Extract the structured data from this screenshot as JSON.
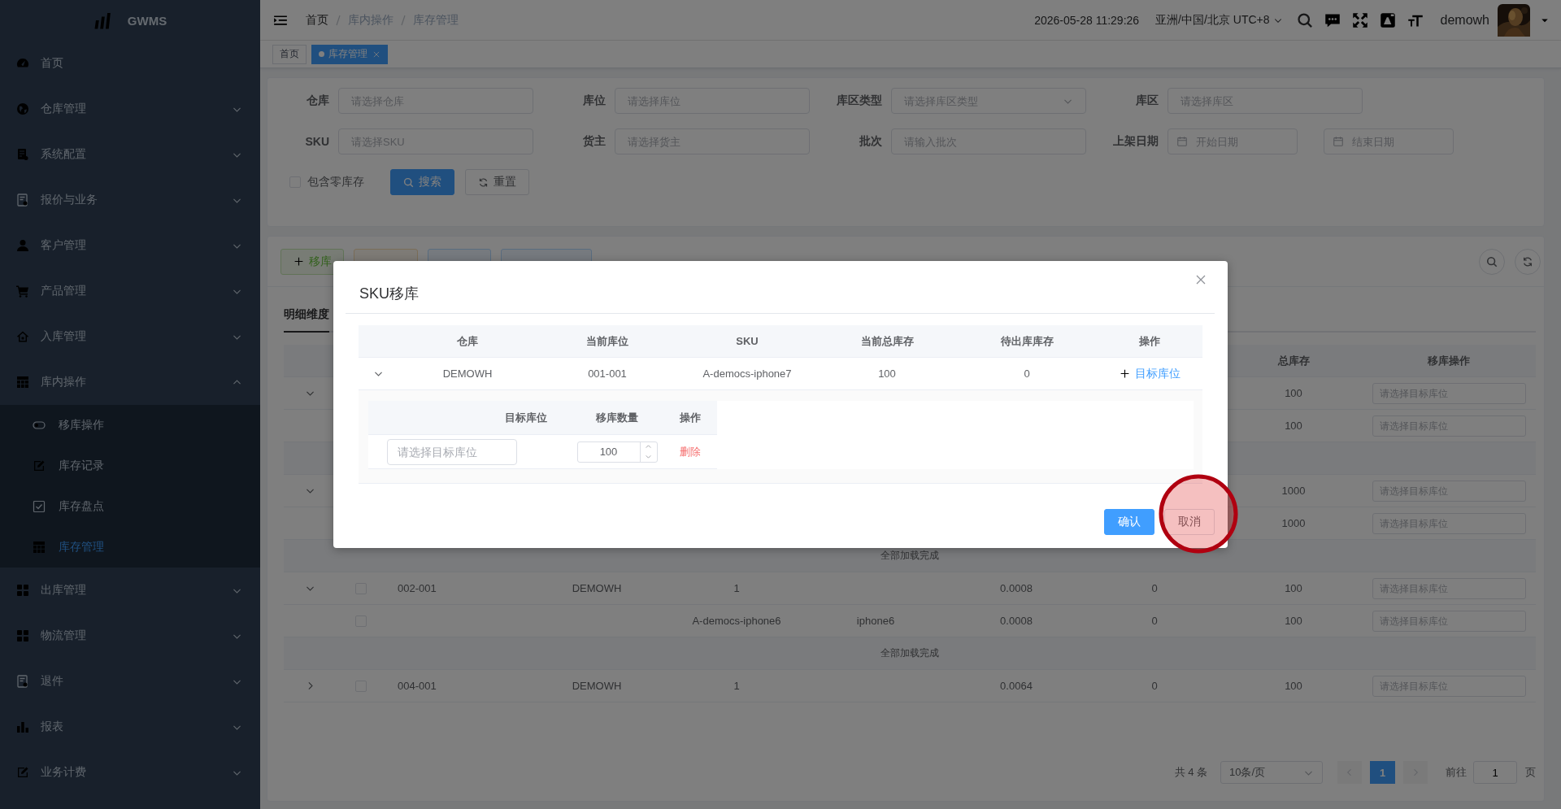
{
  "sidebar": {
    "logo": "GWMS",
    "items": [
      {
        "label": "首页",
        "selected": false
      },
      {
        "label": "仓库管理",
        "selected": false,
        "expanded": false
      },
      {
        "label": "系统配置",
        "selected": false,
        "expanded": false
      },
      {
        "label": "报价与业务",
        "selected": false,
        "expanded": false
      },
      {
        "label": "客户管理",
        "selected": false,
        "expanded": false
      },
      {
        "label": "产品管理",
        "selected": false,
        "expanded": false
      },
      {
        "label": "入库管理",
        "selected": false,
        "expanded": false
      },
      {
        "label": "库内操作",
        "selected": false,
        "expanded": true,
        "children": [
          {
            "label": "移库操作",
            "selected": false
          },
          {
            "label": "库存记录",
            "selected": false
          },
          {
            "label": "库存盘点",
            "selected": false
          },
          {
            "label": "库存管理",
            "selected": true
          }
        ]
      },
      {
        "label": "出库管理",
        "selected": false,
        "expanded": false
      },
      {
        "label": "物流管理",
        "selected": false,
        "expanded": false
      },
      {
        "label": "退件",
        "selected": false,
        "expanded": false
      },
      {
        "label": "报表",
        "selected": false,
        "expanded": false
      },
      {
        "label": "业务计费",
        "selected": false,
        "expanded": false
      }
    ]
  },
  "topbar": {
    "breadcrumb": [
      "首页",
      "库内操作",
      "库存管理"
    ],
    "datetime": "2026-05-28 11:29:26",
    "timezone": "亚洲/中国/北京 UTC+8",
    "user": "demowh"
  },
  "tags": [
    {
      "label": "首页",
      "selected": false
    },
    {
      "label": "库存管理",
      "selected": true
    }
  ],
  "filters": [
    {
      "label": "仓库",
      "kind": "input",
      "placeholder": "请选择仓库"
    },
    {
      "label": "库位",
      "kind": "input",
      "placeholder": "请选择库位"
    },
    {
      "label": "库区类型",
      "kind": "select",
      "placeholder": "请选择库区类型"
    },
    {
      "label": "库区",
      "kind": "input",
      "placeholder": "请选择库区"
    },
    {
      "label": "SKU",
      "kind": "input",
      "placeholder": "请选择SKU"
    },
    {
      "label": "货主",
      "kind": "input",
      "placeholder": "请选择货主"
    },
    {
      "label": "批次",
      "kind": "input",
      "placeholder": "请输入批次"
    },
    {
      "label": "上架日期",
      "kind": "daterange",
      "start_placeholder": "开始日期",
      "end_placeholder": "结束日期"
    }
  ],
  "include_zero": {
    "label": "包含零库存",
    "checked": false
  },
  "filter_buttons": [
    {
      "label": "搜索",
      "kind": "primary"
    },
    {
      "label": "重置",
      "kind": "default"
    }
  ],
  "toolbar": [
    {
      "label": "移库",
      "kind": "success"
    },
    {
      "kind": "warning"
    },
    {
      "kind": "primary"
    },
    {
      "kind": "primary"
    }
  ],
  "view_tabs": [
    {
      "label": "明细维度",
      "selected": true
    }
  ],
  "table": {
    "columns": [
      {
        "label": "总库存"
      },
      {
        "label": "移库操作"
      }
    ],
    "rows": [
      {
        "kind": "parent",
        "expanded": true,
        "total": "100",
        "target_placeholder": "请选择目标库位"
      },
      {
        "kind": "child",
        "total": "100",
        "target_placeholder": "请选择目标库位"
      },
      {
        "kind": "footer"
      },
      {
        "kind": "parent",
        "expanded": true,
        "total": "1000",
        "target_placeholder": "请选择目标库位"
      },
      {
        "kind": "child",
        "total": "1000",
        "target_placeholder": "请选择目标库位"
      },
      {
        "kind": "footer",
        "text": "全部加载完成"
      },
      {
        "kind": "parent",
        "expanded": true,
        "checked": false,
        "location": "002-001",
        "warehouse": "DEMOWH",
        "count": "1",
        "volume": "0.0008",
        "pending": "0",
        "total": "100",
        "target_placeholder": "请选择目标库位"
      },
      {
        "kind": "child",
        "checked": false,
        "sku": "A-democs-iphone6",
        "name": "iphone6",
        "volume": "0.0008",
        "pending": "0",
        "total": "100",
        "target_placeholder": "请选择目标库位"
      },
      {
        "kind": "footer",
        "text": "全部加载完成"
      },
      {
        "kind": "parent",
        "expanded": false,
        "checked": false,
        "location": "004-001",
        "warehouse": "DEMOWH",
        "count": "1",
        "volume": "0.0064",
        "pending": "0",
        "total": "100",
        "target_placeholder": "请选择目标库位"
      }
    ]
  },
  "pagination": {
    "total": "共 4 条",
    "page_size": "10条/页",
    "pages": [
      {
        "label": "1",
        "selected": true
      }
    ],
    "goto_label": "前往",
    "goto_value": "1",
    "page_suffix": "页"
  },
  "dialog": {
    "title": "SKU移库",
    "columns": [
      "仓库",
      "当前库位",
      "SKU",
      "当前总库存",
      "待出库库存",
      "操作"
    ],
    "rows": [
      {
        "expanded": true,
        "warehouse": "DEMOWH",
        "location": "001-001",
        "sku": "A-democs-iphone7",
        "total": "100",
        "pending": "0",
        "action": "目标库位",
        "detail": {
          "columns": [
            "目标库位",
            "移库数量",
            "操作"
          ],
          "rows": [
            {
              "placeholder": "请选择目标库位",
              "quantity": "100",
              "action": "删除"
            }
          ]
        }
      }
    ],
    "buttons": [
      {
        "label": "确认",
        "kind": "primary"
      },
      {
        "label": "取消",
        "kind": "default"
      }
    ]
  }
}
